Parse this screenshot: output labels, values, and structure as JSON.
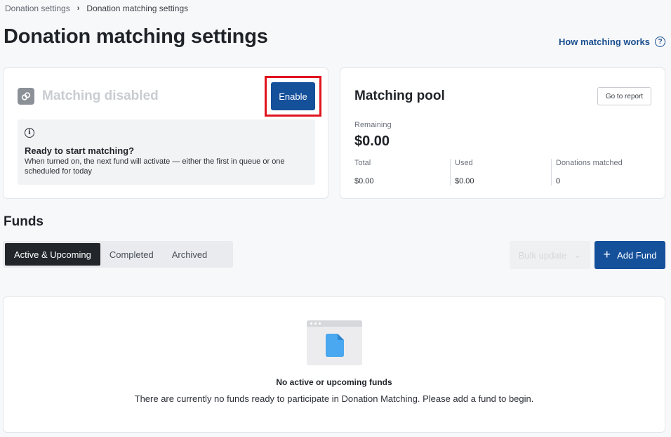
{
  "breadcrumb": {
    "parent": "Donation settings",
    "separator": "›",
    "current": "Donation matching settings"
  },
  "page": {
    "title": "Donation matching settings",
    "help_link": "How matching works",
    "help_icon": "?"
  },
  "status_card": {
    "title": "Matching disabled",
    "icon": "link-icon",
    "enable_label": "Enable",
    "info_icon": "i",
    "info_title": "Ready to start matching?",
    "info_text": "When turned on, the next fund will activate — either the first in queue or one scheduled for today"
  },
  "pool_card": {
    "title": "Matching pool",
    "report_label": "Go to report",
    "remaining_label": "Remaining",
    "remaining_value": "$0.00",
    "stats": [
      {
        "label": "Total",
        "value": "$0.00"
      },
      {
        "label": "Used",
        "value": "$0.00"
      },
      {
        "label": "Donations matched",
        "value": "0"
      }
    ]
  },
  "funds": {
    "title": "Funds",
    "tabs": [
      {
        "label": "Active & Upcoming",
        "active": true
      },
      {
        "label": "Completed",
        "active": false
      },
      {
        "label": "Archived",
        "active": false
      }
    ],
    "bulk_label": "Bulk update",
    "bulk_icon": "⌄",
    "add_label": "Add Fund",
    "add_icon": "+",
    "empty_title": "No active or upcoming funds",
    "empty_text": "There are currently no funds ready to participate in Donation Matching. Please add a fund to begin."
  },
  "colors": {
    "primary": "#15509b",
    "highlight": "#e0141e",
    "file_icon": "#4aa8f0"
  }
}
